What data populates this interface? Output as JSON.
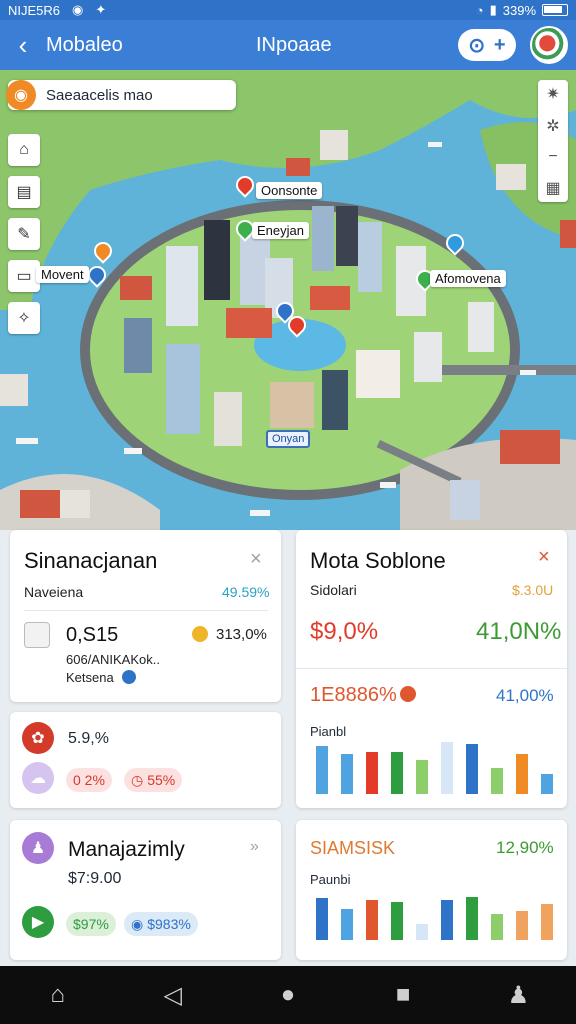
{
  "status_bar": {
    "left_text": "NIJE5R6",
    "battery": "339%"
  },
  "app_bar": {
    "title": "Mobaleo",
    "center_title": "INpoaae"
  },
  "map": {
    "search_placeholder": "Saeaacelis mao",
    "labels": [
      "Oonsonte",
      "Eneyjan",
      "Movent",
      "Afomovena"
    ],
    "center_sign": "Onyan"
  },
  "card1": {
    "title": "Sinanacjanan",
    "subtitle": "Naveiena",
    "subtitle_value": "49.59%",
    "metric": "0,S15",
    "metric_right": "313,0%",
    "detail": "606/ANIKAKok..",
    "detail2": "Ketsena"
  },
  "card2": {
    "title": "Mota Soblone",
    "subtitle": "Sidolari",
    "subtitle_value": "$.3.0U",
    "value_left": "$9,0%",
    "value_right": "41,0N%",
    "stat_left": "1E8886%",
    "stat_right": "41,00%",
    "chart_label": "Pianbl"
  },
  "card3": {
    "value": "5.9,%",
    "chip1": "0 2%",
    "chip2": "55%"
  },
  "card4": {
    "title": "SIAMSISK",
    "value": "12,90%",
    "chart_label": "Paunbi"
  },
  "card5": {
    "title": "Manajazimly",
    "value": "$7:9.00",
    "chip1": "$97%",
    "chip2": "$983%"
  },
  "colors": {
    "primary": "#3a7fd5",
    "green": "#2e9d3f",
    "red": "#e23b2a",
    "blue_light": "#4ea3e0"
  },
  "chart_data": [
    {
      "type": "bar",
      "series": [
        {
          "values": [
            48,
            40,
            42,
            42,
            34,
            52,
            50,
            26,
            40,
            20
          ]
        }
      ],
      "ylim": [
        0,
        60
      ]
    },
    {
      "type": "bar",
      "series": [
        {
          "values": [
            48,
            36,
            46,
            44,
            18,
            46,
            50,
            30,
            34,
            42
          ]
        }
      ],
      "ylim": [
        0,
        60
      ]
    }
  ],
  "nav": {
    "home_label": ""
  }
}
